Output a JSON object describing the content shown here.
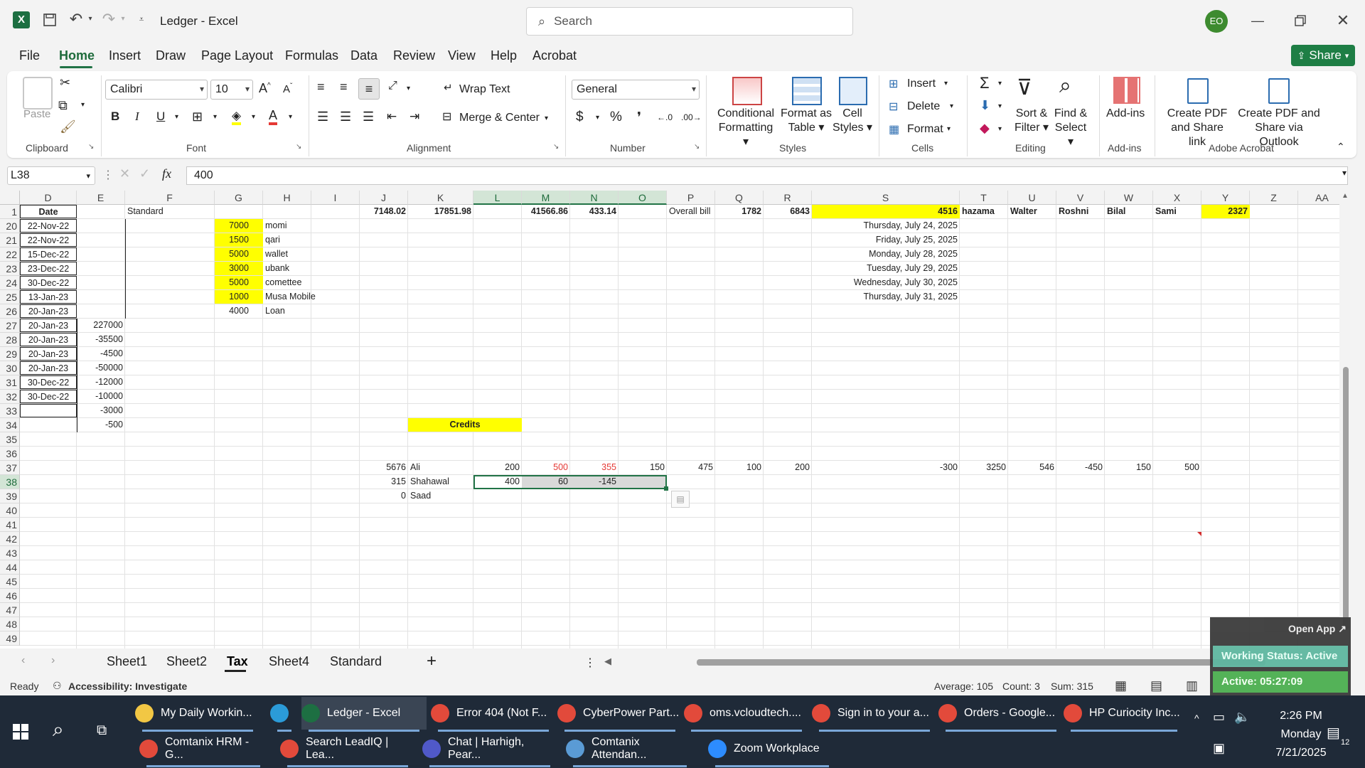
{
  "window": {
    "title": "Ledger  -  Excel",
    "avatar": "EO"
  },
  "search": {
    "placeholder": "Search"
  },
  "menu": [
    "File",
    "Home",
    "Insert",
    "Draw",
    "Page Layout",
    "Formulas",
    "Data",
    "Review",
    "View",
    "Help",
    "Acrobat"
  ],
  "share_label": "Share",
  "ribbon": {
    "clipboard": {
      "paste": "Paste",
      "label": "Clipboard"
    },
    "font": {
      "name": "Calibri",
      "size": "10",
      "label": "Font"
    },
    "alignment": {
      "wrap": "Wrap Text",
      "merge": "Merge & Center",
      "label": "Alignment"
    },
    "number": {
      "format": "General",
      "label": "Number"
    },
    "styles": {
      "cond1": "Conditional",
      "cond2": "Formatting",
      "fmt1": "Format as",
      "fmt2": "Table",
      "cell1": "Cell",
      "cell2": "Styles",
      "label": "Styles"
    },
    "cells": {
      "insert": "Insert",
      "delete": "Delete",
      "format": "Format",
      "label": "Cells"
    },
    "editing": {
      "sort1": "Sort &",
      "sort2": "Filter",
      "find1": "Find &",
      "find2": "Select",
      "label": "Editing"
    },
    "addins": {
      "btn": "Add-ins",
      "label": "Add-ins"
    },
    "acrobat": {
      "a1": "Create PDF",
      "a2": "and Share link",
      "b1": "Create PDF and",
      "b2": "Share via Outlook",
      "label": "Adobe Acrobat"
    }
  },
  "formula_bar": {
    "namebox": "L38",
    "fx": "fx",
    "value": "400"
  },
  "columns": [
    "D",
    "E",
    "F",
    "G",
    "H",
    "I",
    "J",
    "K",
    "L",
    "M",
    "N",
    "O",
    "P",
    "Q",
    "R",
    "S",
    "T",
    "U",
    "V",
    "W",
    "X",
    "Y",
    "Z",
    "AA"
  ],
  "rows": [
    "1",
    "20",
    "21",
    "22",
    "23",
    "24",
    "25",
    "26",
    "27",
    "28",
    "29",
    "30",
    "31",
    "32",
    "33",
    "34",
    "35",
    "36",
    "37",
    "38",
    "39",
    "40",
    "41",
    "42",
    "43",
    "44",
    "45",
    "46",
    "47",
    "48",
    "49"
  ],
  "cells": {
    "r1": {
      "D": "Date",
      "F": "Standard",
      "J": "7148.02",
      "K": "17851.98",
      "M": "41566.86",
      "N": "433.14",
      "P": "Overall bill",
      "Q": "1782",
      "R": "6843",
      "S": "4516",
      "T": "hazama",
      "U": "Walter",
      "V": "Roshni",
      "W": "Bilal",
      "X": "Sami",
      "Y": "2327"
    },
    "dates": [
      "22-Nov-22",
      "22-Nov-22",
      "15-Dec-22",
      "23-Dec-22",
      "30-Dec-22",
      "13-Jan-23",
      "20-Jan-23",
      "20-Jan-23",
      "20-Jan-23",
      "20-Jan-23",
      "20-Jan-23",
      "30-Dec-22",
      "30-Dec-22"
    ],
    "e_vals": [
      "227000",
      "-35500",
      "-4500",
      "-50000",
      "-12000",
      "-10000",
      "-3000",
      "-500"
    ],
    "g_vals": [
      "7000",
      "1500",
      "5000",
      "3000",
      "5000",
      "1000",
      "4000"
    ],
    "h_vals": [
      "momi",
      "qari",
      "wallet",
      "ubank",
      "comettee",
      "Musa Mobile",
      "Loan"
    ],
    "s_dates": [
      "Thursday, July 24, 2025",
      "Friday, July 25, 2025",
      "Monday, July 28, 2025",
      "Tuesday, July 29, 2025",
      "Wednesday, July 30, 2025",
      "Thursday, July 31, 2025"
    ],
    "credits": "Credits",
    "r37": {
      "J": "5676",
      "K": "Ali",
      "L": "200",
      "M": "500",
      "N": "355",
      "O": "150",
      "P": "475",
      "Q": "100",
      "R": "200",
      "S": "-300",
      "T": "3250",
      "U": "546",
      "V": "-450",
      "W": "150",
      "X": "500"
    },
    "r38": {
      "J": "315",
      "K": "Shahawal",
      "L": "400",
      "M": "60",
      "N": "-145"
    },
    "r39": {
      "J": "0",
      "K": "Saad"
    }
  },
  "sheet_tabs": [
    "Sheet1",
    "Sheet2",
    "Tax",
    "Sheet4",
    "Standard"
  ],
  "status": {
    "ready": "Ready",
    "accessibility": "Accessibility: Investigate",
    "average": "Average: 105",
    "count": "Count: 3",
    "sum": "Sum: 315"
  },
  "overlay": {
    "open_app": "Open App ↗",
    "working": "Working Status: Active",
    "active": "Active: 05:27:09"
  },
  "taskbar": {
    "row1": [
      "My Daily Workin...",
      "",
      "Ledger - Excel",
      "Error 404 (Not F...",
      "CyberPower Part...",
      "oms.vcloudtech....",
      "Sign in to your a...",
      "Orders - Google...",
      "HP Curiocity Inc..."
    ],
    "row2": [
      "Comtanix HRM - G...",
      "Search LeadIQ | Lea...",
      "Chat | Harhigh, Pear...",
      "Comtanix Attendan...",
      "Zoom Workplace"
    ],
    "time": "2:26 PM",
    "day": "Monday",
    "date": "7/21/2025",
    "notif": "12"
  },
  "colors": {
    "excel_green": "#217346",
    "highlight": "#ffff00",
    "taskbar": "#1f2a38"
  }
}
